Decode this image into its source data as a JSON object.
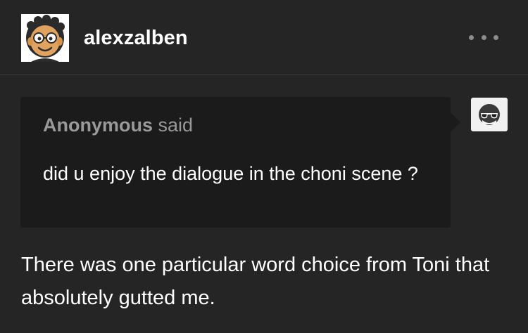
{
  "post": {
    "author": {
      "username": "alexzalben",
      "avatar_icon": "cartoon-face-glasses-icon"
    },
    "menu_icon": "more-options-icon"
  },
  "ask": {
    "asker_name": "Anonymous",
    "asker_suffix": " said",
    "asker_avatar_icon": "anonymous-sunglasses-icon",
    "question": "did u enjoy the dialogue in the choni scene ?"
  },
  "answer": {
    "text": "There was one particular word choice from Toni that absolutely gutted me."
  },
  "colors": {
    "background": "#252525",
    "bubble": "#1b1b1b",
    "muted_text": "#999999",
    "text": "#ffffff"
  }
}
